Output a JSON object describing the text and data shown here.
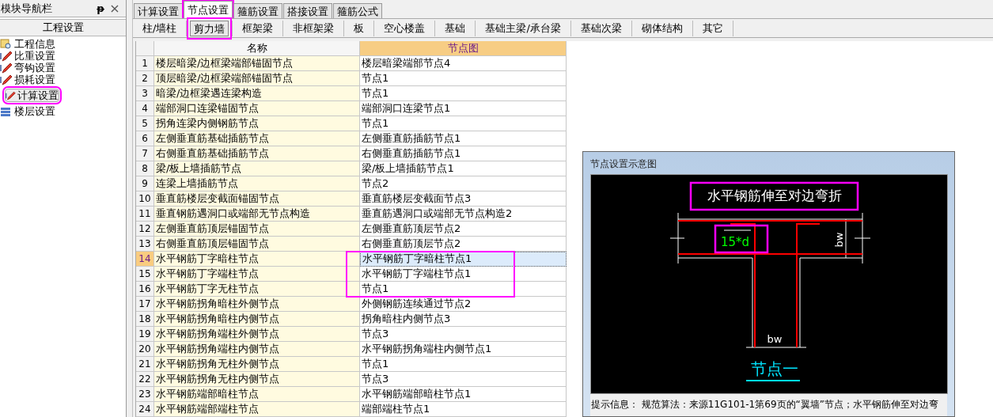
{
  "nav_panel": {
    "title": "模块导航栏",
    "pin": "ᵽ",
    "close": "×",
    "section": "工程设置",
    "items": [
      {
        "label": "工程信息",
        "kind": "info",
        "selected": false
      },
      {
        "label": "比重设置",
        "kind": "pencil",
        "selected": false
      },
      {
        "label": "弯钩设置",
        "kind": "pencil",
        "selected": false
      },
      {
        "label": "损耗设置",
        "kind": "pencil",
        "selected": false
      },
      {
        "label": "计算设置",
        "kind": "pencil",
        "selected": true
      },
      {
        "label": "楼层设置",
        "kind": "floor",
        "selected": false
      }
    ]
  },
  "tabs": [
    {
      "label": "计算设置",
      "selected": false
    },
    {
      "label": "节点设置",
      "selected": true
    },
    {
      "label": "箍筋设置",
      "selected": false
    },
    {
      "label": "搭接设置",
      "selected": false
    },
    {
      "label": "箍筋公式",
      "selected": false
    }
  ],
  "subtabs": [
    {
      "label": "柱/墙柱",
      "selected": false
    },
    {
      "label": "剪力墙",
      "selected": true
    },
    {
      "label": "框架梁",
      "selected": false
    },
    {
      "label": "非框架梁",
      "selected": false
    },
    {
      "label": "板",
      "selected": false
    },
    {
      "label": "空心楼盖",
      "selected": false
    },
    {
      "label": "基础",
      "selected": false
    },
    {
      "label": "基础主梁/承台梁",
      "selected": false
    },
    {
      "label": "基础次梁",
      "selected": false
    },
    {
      "label": "砌体结构",
      "selected": false
    },
    {
      "label": "其它",
      "selected": false
    }
  ],
  "table": {
    "columns": [
      "名称",
      "节点图"
    ],
    "rows": [
      {
        "index": "1",
        "name": "楼层暗梁/边框梁端部锚固节点",
        "node": "楼层暗梁端部节点4",
        "selected": false
      },
      {
        "index": "2",
        "name": "顶层暗梁/边框梁端部锚固节点",
        "node": "节点1",
        "selected": false
      },
      {
        "index": "3",
        "name": "暗梁/边框梁遇连梁构造",
        "node": "节点1",
        "selected": false
      },
      {
        "index": "4",
        "name": "端部洞口连梁锚固节点",
        "node": "端部洞口连梁节点1",
        "selected": false
      },
      {
        "index": "5",
        "name": "拐角连梁内侧钢筋节点",
        "node": "节点1",
        "selected": false
      },
      {
        "index": "6",
        "name": "左侧垂直筋基础插筋节点",
        "node": "左侧垂直筋插筋节点1",
        "selected": false
      },
      {
        "index": "7",
        "name": "右侧垂直筋基础插筋节点",
        "node": "右侧垂直筋插筋节点1",
        "selected": false
      },
      {
        "index": "8",
        "name": "梁/板上墙插筋节点",
        "node": "梁/板上墙插筋节点1",
        "selected": false
      },
      {
        "index": "9",
        "name": "连梁上墙插筋节点",
        "node": "节点2",
        "selected": false
      },
      {
        "index": "10",
        "name": "垂直筋楼层变截面锚固节点",
        "node": "垂直筋楼层变截面节点3",
        "selected": false
      },
      {
        "index": "11",
        "name": "垂直钢筋遇洞口或端部无节点构造",
        "node": "垂直筋遇洞口或端部无节点构造2",
        "selected": false
      },
      {
        "index": "12",
        "name": "左侧垂直筋顶层锚固节点",
        "node": "左侧垂直筋顶层节点2",
        "selected": false
      },
      {
        "index": "13",
        "name": "右侧垂直筋顶层锚固节点",
        "node": "右侧垂直筋顶层节点2",
        "selected": false
      },
      {
        "index": "14",
        "name": "水平钢筋丁字暗柱节点",
        "node": "水平钢筋丁字暗柱节点1",
        "selected": true
      },
      {
        "index": "15",
        "name": "水平钢筋丁字端柱节点",
        "node": "水平钢筋丁字端柱节点1",
        "selected": false
      },
      {
        "index": "16",
        "name": "水平钢筋丁字无柱节点",
        "node": "节点1",
        "selected": false
      },
      {
        "index": "17",
        "name": "水平钢筋拐角暗柱外侧节点",
        "node": "外侧钢筋连续通过节点2",
        "selected": false
      },
      {
        "index": "18",
        "name": "水平钢筋拐角暗柱内侧节点",
        "node": "拐角暗柱内侧节点3",
        "selected": false
      },
      {
        "index": "19",
        "name": "水平钢筋拐角端柱外侧节点",
        "node": "节点3",
        "selected": false
      },
      {
        "index": "20",
        "name": "水平钢筋拐角端柱内侧节点",
        "node": "水平钢筋拐角端柱内侧节点1",
        "selected": false
      },
      {
        "index": "21",
        "name": "水平钢筋拐角无柱外侧节点",
        "node": "节点1",
        "selected": false
      },
      {
        "index": "22",
        "name": "水平钢筋拐角无柱内侧节点",
        "node": "节点3",
        "selected": false
      },
      {
        "index": "23",
        "name": "水平钢筋端部暗柱节点",
        "node": "水平钢筋端部暗柱节点1",
        "selected": false
      },
      {
        "index": "24",
        "name": "水平钢筋端部端柱节点",
        "node": "端部端柱节点1",
        "selected": false
      }
    ]
  },
  "preview": {
    "title": "节点设置示意图",
    "diagram_title": "水平钢筋伸至对边弯折",
    "dimension": "15*d",
    "flange_label": "bw",
    "web_label": "bw",
    "caption": "节点一",
    "hint": "提示信息： 规范算法：来源11G101-1第69页的“翼墙”节点；水平钢筋伸至对边弯"
  }
}
